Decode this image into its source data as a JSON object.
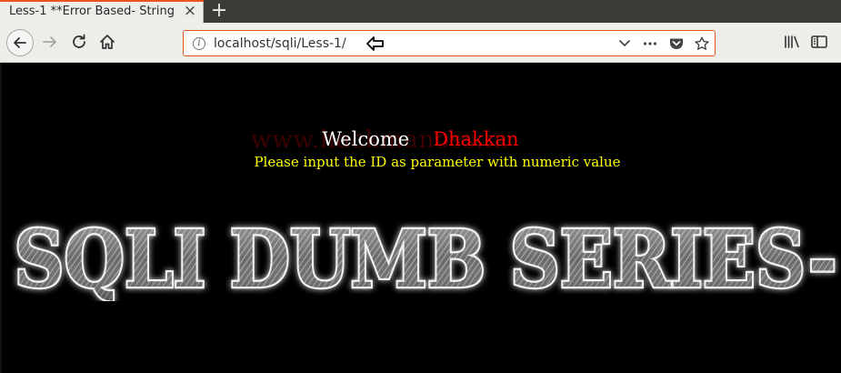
{
  "tab": {
    "title": "Less-1 **Error Based- String",
    "close_icon": "close-icon",
    "new_tab_icon": "plus-icon"
  },
  "nav": {
    "back_icon": "back-arrow-icon",
    "forward_icon": "forward-arrow-icon",
    "reload_icon": "reload-icon",
    "home_icon": "home-icon"
  },
  "url": {
    "value": "localhost/sqli/Less-1/",
    "icons": [
      "info-icon",
      "chevron-down-icon",
      "more-dots-icon",
      "pocket-icon",
      "star-icon"
    ]
  },
  "toolbar_right": {
    "icons": [
      "library-icon",
      "sidebar-icon"
    ]
  },
  "page": {
    "welcome": "Welcome",
    "name": "Dhakkan",
    "watermark": "www.hackmanoss.in",
    "instruction": "Please input the ID as parameter with numeric value",
    "banner": "SQLI DUMB SERIES-",
    "colors": {
      "background": "#000000",
      "welcome": "#ffffff",
      "name": "#ff0000",
      "instruction": "#ffff00"
    }
  }
}
